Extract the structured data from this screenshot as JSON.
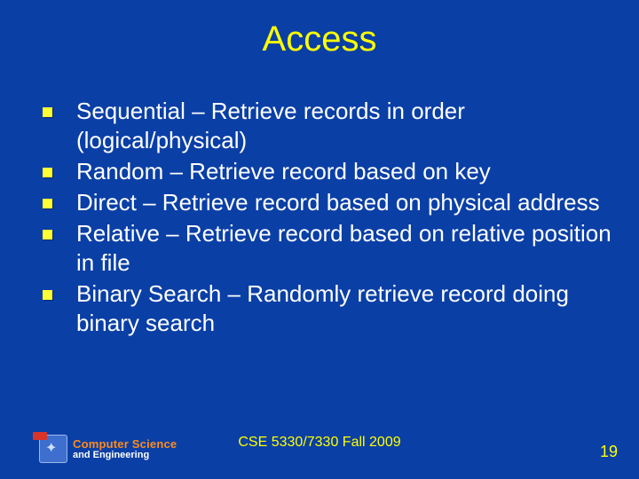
{
  "title": "Access",
  "bullets": [
    "Sequential – Retrieve records in order (logical/physical)",
    "Random – Retrieve record based on key",
    "Direct – Retrieve record based on physical address",
    "Relative – Retrieve record based on relative position in file",
    "Binary Search – Randomly retrieve record doing binary search"
  ],
  "footer": {
    "course": "CSE 5330/7330 Fall 2009",
    "page": "19"
  },
  "logo": {
    "line1": "Computer Science",
    "line2": "and Engineering"
  }
}
